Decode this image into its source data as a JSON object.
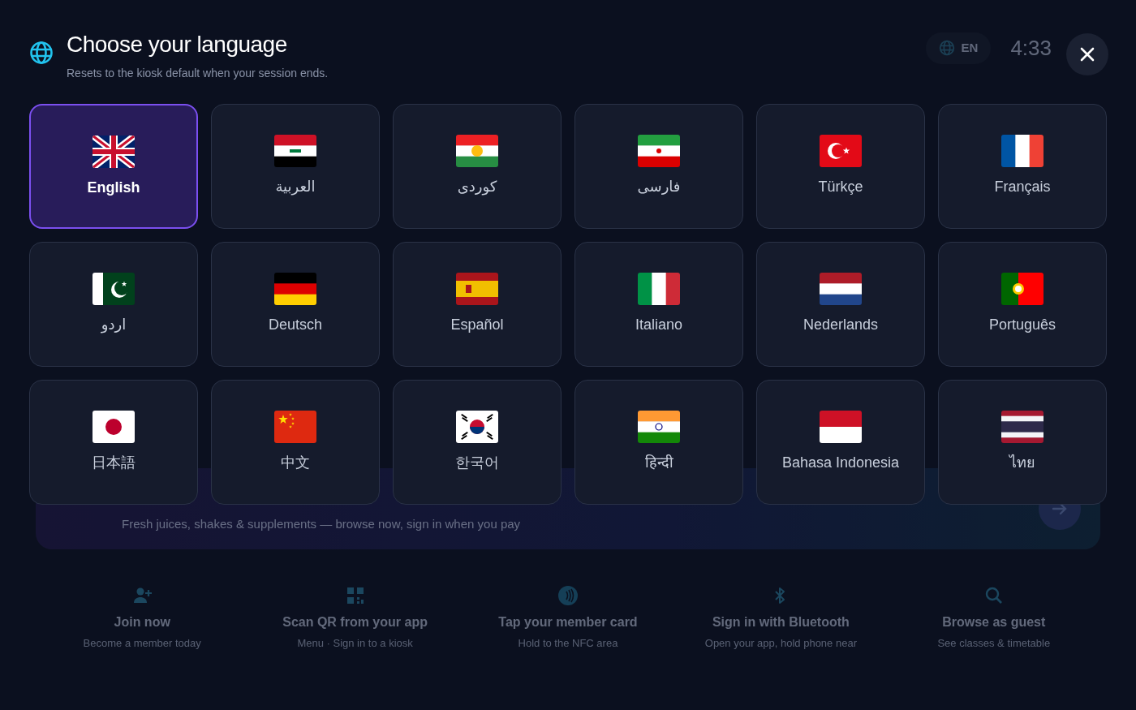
{
  "background": {
    "language_button": {
      "label": "EN"
    },
    "clock": "4:33",
    "order_card": {
      "subtitle": "Fresh juices, shakes & supplements — browse now, sign in when you pay"
    },
    "actions": [
      {
        "kind": "join",
        "title": "Join now",
        "subtitle": "Become a member today"
      },
      {
        "kind": "qr",
        "title": "Scan QR from your app",
        "subtitle": "Menu · Sign in to a kiosk"
      },
      {
        "kind": "nfc",
        "title": "Tap your member card",
        "subtitle": "Hold to the NFC area"
      },
      {
        "kind": "bluetooth",
        "title": "Sign in with Bluetooth",
        "subtitle": "Open your app, hold phone near"
      },
      {
        "kind": "search",
        "title": "Browse as guest",
        "subtitle": "See classes & timetable"
      }
    ]
  },
  "header": {
    "title": "Choose your language",
    "subtitle": "Resets to the kiosk default when your session ends."
  },
  "languages": [
    {
      "kind": "gb",
      "label": "English",
      "selected": true
    },
    {
      "kind": "iq",
      "label": "العربية",
      "selected": false
    },
    {
      "kind": "kurd",
      "label": "کوردی",
      "selected": false
    },
    {
      "kind": "ir",
      "label": "فارسی",
      "selected": false
    },
    {
      "kind": "tr",
      "label": "Türkçe",
      "selected": false
    },
    {
      "kind": "fr",
      "label": "Français",
      "selected": false
    },
    {
      "kind": "pk",
      "label": "اردو",
      "selected": false
    },
    {
      "kind": "de",
      "label": "Deutsch",
      "selected": false
    },
    {
      "kind": "es",
      "label": "Español",
      "selected": false
    },
    {
      "kind": "it",
      "label": "Italiano",
      "selected": false
    },
    {
      "kind": "nl",
      "label": "Nederlands",
      "selected": false
    },
    {
      "kind": "pt",
      "label": "Português",
      "selected": false
    },
    {
      "kind": "jp",
      "label": "日本語",
      "selected": false
    },
    {
      "kind": "cn",
      "label": "中文",
      "selected": false
    },
    {
      "kind": "kr",
      "label": "한국어",
      "selected": false
    },
    {
      "kind": "in",
      "label": "हिन्दी",
      "selected": false
    },
    {
      "kind": "id",
      "label": "Bahasa Indonesia",
      "selected": false
    },
    {
      "kind": "th",
      "label": "ไทย",
      "selected": false
    }
  ]
}
